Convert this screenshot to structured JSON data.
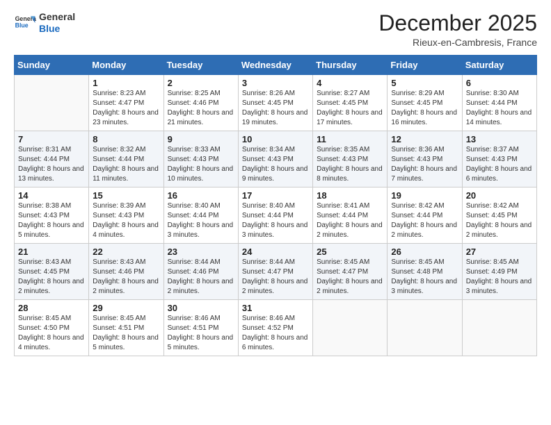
{
  "logo": {
    "line1": "General",
    "line2": "Blue"
  },
  "header": {
    "month": "December 2025",
    "location": "Rieux-en-Cambresis, France"
  },
  "weekdays": [
    "Sunday",
    "Monday",
    "Tuesday",
    "Wednesday",
    "Thursday",
    "Friday",
    "Saturday"
  ],
  "weeks": [
    [
      {
        "day": "",
        "sunrise": "",
        "sunset": "",
        "daylight": ""
      },
      {
        "day": "1",
        "sunrise": "Sunrise: 8:23 AM",
        "sunset": "Sunset: 4:47 PM",
        "daylight": "Daylight: 8 hours and 23 minutes."
      },
      {
        "day": "2",
        "sunrise": "Sunrise: 8:25 AM",
        "sunset": "Sunset: 4:46 PM",
        "daylight": "Daylight: 8 hours and 21 minutes."
      },
      {
        "day": "3",
        "sunrise": "Sunrise: 8:26 AM",
        "sunset": "Sunset: 4:45 PM",
        "daylight": "Daylight: 8 hours and 19 minutes."
      },
      {
        "day": "4",
        "sunrise": "Sunrise: 8:27 AM",
        "sunset": "Sunset: 4:45 PM",
        "daylight": "Daylight: 8 hours and 17 minutes."
      },
      {
        "day": "5",
        "sunrise": "Sunrise: 8:29 AM",
        "sunset": "Sunset: 4:45 PM",
        "daylight": "Daylight: 8 hours and 16 minutes."
      },
      {
        "day": "6",
        "sunrise": "Sunrise: 8:30 AM",
        "sunset": "Sunset: 4:44 PM",
        "daylight": "Daylight: 8 hours and 14 minutes."
      }
    ],
    [
      {
        "day": "7",
        "sunrise": "Sunrise: 8:31 AM",
        "sunset": "Sunset: 4:44 PM",
        "daylight": "Daylight: 8 hours and 13 minutes."
      },
      {
        "day": "8",
        "sunrise": "Sunrise: 8:32 AM",
        "sunset": "Sunset: 4:44 PM",
        "daylight": "Daylight: 8 hours and 11 minutes."
      },
      {
        "day": "9",
        "sunrise": "Sunrise: 8:33 AM",
        "sunset": "Sunset: 4:43 PM",
        "daylight": "Daylight: 8 hours and 10 minutes."
      },
      {
        "day": "10",
        "sunrise": "Sunrise: 8:34 AM",
        "sunset": "Sunset: 4:43 PM",
        "daylight": "Daylight: 8 hours and 9 minutes."
      },
      {
        "day": "11",
        "sunrise": "Sunrise: 8:35 AM",
        "sunset": "Sunset: 4:43 PM",
        "daylight": "Daylight: 8 hours and 8 minutes."
      },
      {
        "day": "12",
        "sunrise": "Sunrise: 8:36 AM",
        "sunset": "Sunset: 4:43 PM",
        "daylight": "Daylight: 8 hours and 7 minutes."
      },
      {
        "day": "13",
        "sunrise": "Sunrise: 8:37 AM",
        "sunset": "Sunset: 4:43 PM",
        "daylight": "Daylight: 8 hours and 6 minutes."
      }
    ],
    [
      {
        "day": "14",
        "sunrise": "Sunrise: 8:38 AM",
        "sunset": "Sunset: 4:43 PM",
        "daylight": "Daylight: 8 hours and 5 minutes."
      },
      {
        "day": "15",
        "sunrise": "Sunrise: 8:39 AM",
        "sunset": "Sunset: 4:43 PM",
        "daylight": "Daylight: 8 hours and 4 minutes."
      },
      {
        "day": "16",
        "sunrise": "Sunrise: 8:40 AM",
        "sunset": "Sunset: 4:44 PM",
        "daylight": "Daylight: 8 hours and 3 minutes."
      },
      {
        "day": "17",
        "sunrise": "Sunrise: 8:40 AM",
        "sunset": "Sunset: 4:44 PM",
        "daylight": "Daylight: 8 hours and 3 minutes."
      },
      {
        "day": "18",
        "sunrise": "Sunrise: 8:41 AM",
        "sunset": "Sunset: 4:44 PM",
        "daylight": "Daylight: 8 hours and 2 minutes."
      },
      {
        "day": "19",
        "sunrise": "Sunrise: 8:42 AM",
        "sunset": "Sunset: 4:44 PM",
        "daylight": "Daylight: 8 hours and 2 minutes."
      },
      {
        "day": "20",
        "sunrise": "Sunrise: 8:42 AM",
        "sunset": "Sunset: 4:45 PM",
        "daylight": "Daylight: 8 hours and 2 minutes."
      }
    ],
    [
      {
        "day": "21",
        "sunrise": "Sunrise: 8:43 AM",
        "sunset": "Sunset: 4:45 PM",
        "daylight": "Daylight: 8 hours and 2 minutes."
      },
      {
        "day": "22",
        "sunrise": "Sunrise: 8:43 AM",
        "sunset": "Sunset: 4:46 PM",
        "daylight": "Daylight: 8 hours and 2 minutes."
      },
      {
        "day": "23",
        "sunrise": "Sunrise: 8:44 AM",
        "sunset": "Sunset: 4:46 PM",
        "daylight": "Daylight: 8 hours and 2 minutes."
      },
      {
        "day": "24",
        "sunrise": "Sunrise: 8:44 AM",
        "sunset": "Sunset: 4:47 PM",
        "daylight": "Daylight: 8 hours and 2 minutes."
      },
      {
        "day": "25",
        "sunrise": "Sunrise: 8:45 AM",
        "sunset": "Sunset: 4:47 PM",
        "daylight": "Daylight: 8 hours and 2 minutes."
      },
      {
        "day": "26",
        "sunrise": "Sunrise: 8:45 AM",
        "sunset": "Sunset: 4:48 PM",
        "daylight": "Daylight: 8 hours and 3 minutes."
      },
      {
        "day": "27",
        "sunrise": "Sunrise: 8:45 AM",
        "sunset": "Sunset: 4:49 PM",
        "daylight": "Daylight: 8 hours and 3 minutes."
      }
    ],
    [
      {
        "day": "28",
        "sunrise": "Sunrise: 8:45 AM",
        "sunset": "Sunset: 4:50 PM",
        "daylight": "Daylight: 8 hours and 4 minutes."
      },
      {
        "day": "29",
        "sunrise": "Sunrise: 8:45 AM",
        "sunset": "Sunset: 4:51 PM",
        "daylight": "Daylight: 8 hours and 5 minutes."
      },
      {
        "day": "30",
        "sunrise": "Sunrise: 8:46 AM",
        "sunset": "Sunset: 4:51 PM",
        "daylight": "Daylight: 8 hours and 5 minutes."
      },
      {
        "day": "31",
        "sunrise": "Sunrise: 8:46 AM",
        "sunset": "Sunset: 4:52 PM",
        "daylight": "Daylight: 8 hours and 6 minutes."
      },
      {
        "day": "",
        "sunrise": "",
        "sunset": "",
        "daylight": ""
      },
      {
        "day": "",
        "sunrise": "",
        "sunset": "",
        "daylight": ""
      },
      {
        "day": "",
        "sunrise": "",
        "sunset": "",
        "daylight": ""
      }
    ]
  ]
}
